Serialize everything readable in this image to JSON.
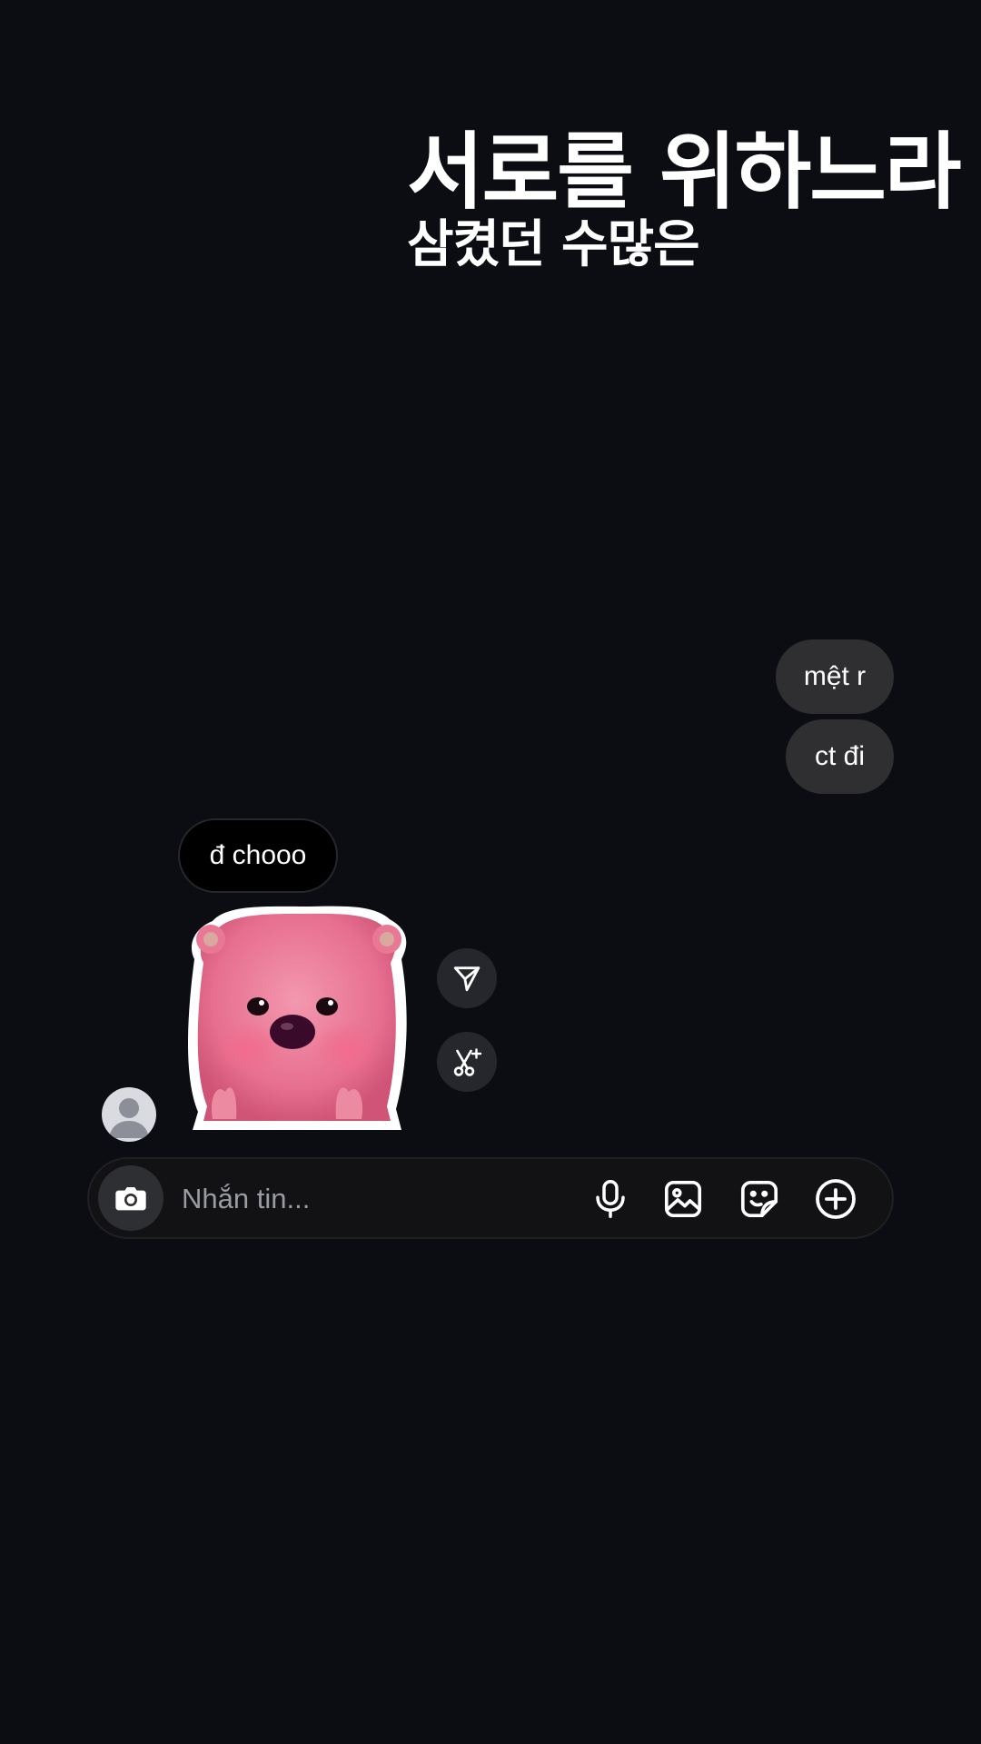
{
  "lyrics": {
    "line1": "서로를 위하느라",
    "line2": "삼켰던 수많은"
  },
  "messages": {
    "outgoing": [
      {
        "text": "mệt r"
      },
      {
        "text": "ct đi"
      }
    ],
    "incoming": [
      {
        "text": "đ chooo"
      }
    ]
  },
  "composer": {
    "placeholder": "Nhắn tin..."
  },
  "icons": {
    "camera": "camera-icon",
    "microphone": "microphone-icon",
    "gallery": "gallery-icon",
    "sticker": "sticker-icon",
    "add": "plus-circle-icon",
    "share": "send-icon",
    "remix": "scissors-sparkle-icon",
    "avatar": "default-avatar-icon"
  },
  "colors": {
    "background": "#0b0d13",
    "outgoing_bubble": "#2f2f31",
    "incoming_bubble": "#000000",
    "composer": "#121214",
    "text": "#ffffff",
    "placeholder": "#9a9ca3"
  }
}
